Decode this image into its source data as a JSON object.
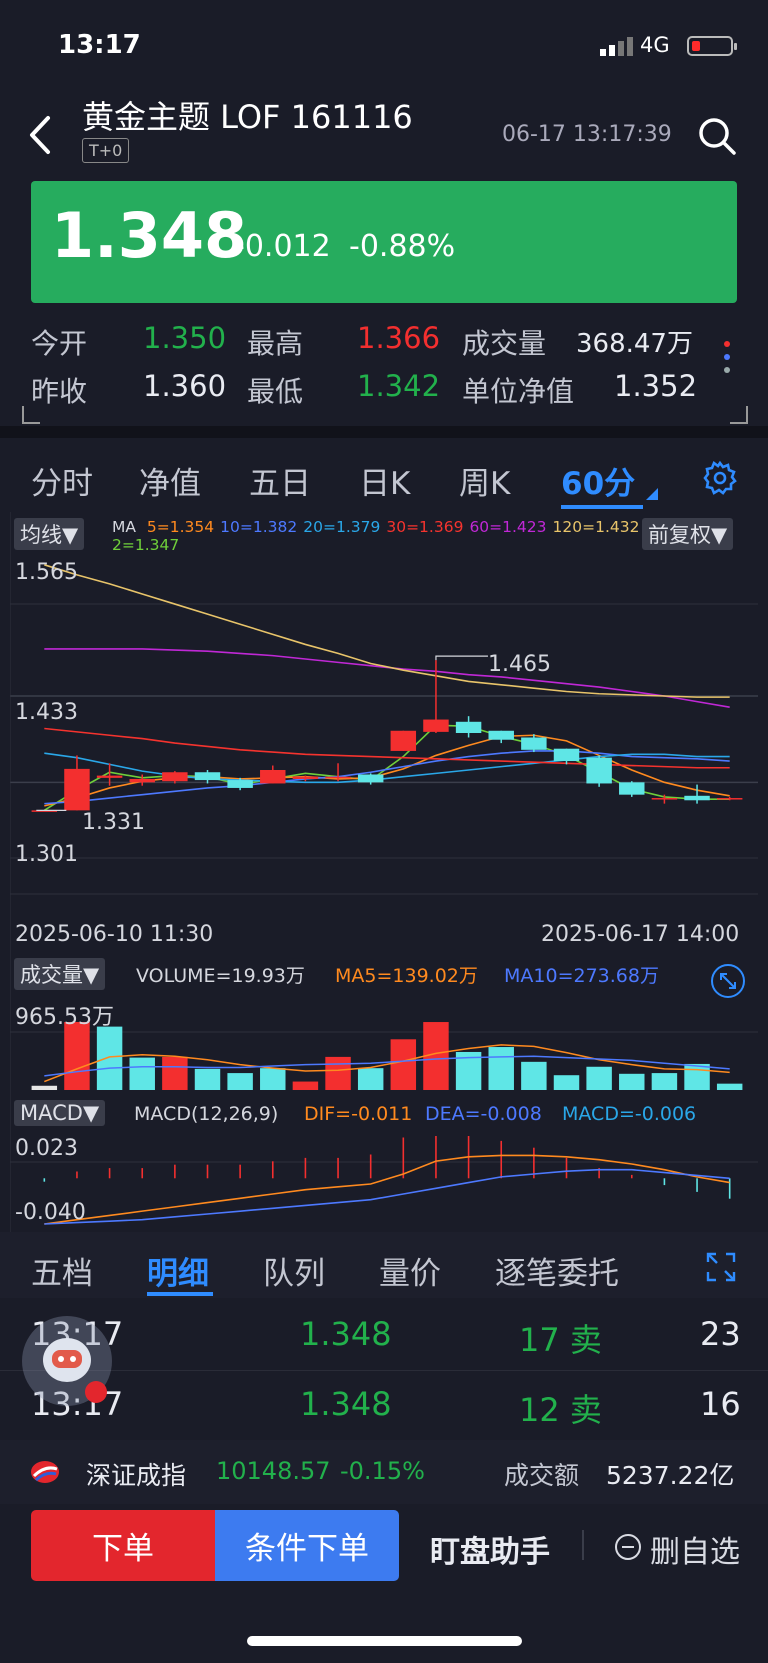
{
  "status": {
    "time": "13:17",
    "network": "4G"
  },
  "header": {
    "title": "黄金主题 LOF 161116",
    "badge": "T+0",
    "timestamp": "06-17 13:17:39"
  },
  "quote": {
    "price": "1.348",
    "change": "-0.012",
    "change_pct": "-0.88%"
  },
  "stats": {
    "open_label": "今开",
    "open": "1.350",
    "high_label": "最高",
    "high": "1.366",
    "volume_label": "成交量",
    "volume": "368.47万",
    "prev_label": "昨收",
    "prev": "1.360",
    "low_label": "最低",
    "low": "1.342",
    "nav_label": "单位净值",
    "nav": "1.352"
  },
  "tabs": [
    "分时",
    "净值",
    "五日",
    "日K",
    "周K",
    "60分"
  ],
  "chart": {
    "ma_pill": "均线▼",
    "ma_prefix": "MA",
    "ma_items": [
      {
        "text": "5=1.354",
        "color": "#ff8a1f"
      },
      {
        "text": "10=1.382",
        "color": "#4d79ff"
      },
      {
        "text": "20=1.379",
        "color": "#2aa7e8"
      },
      {
        "text": "30=1.369",
        "color": "#f5332e"
      },
      {
        "text": "60=1.423",
        "color": "#c028d6"
      },
      {
        "text": "120=1.432",
        "color": "#e8c46a"
      }
    ],
    "ma_item2": {
      "text": "2=1.347",
      "color": "#6fcf3a"
    },
    "adj_pill": "前复权▼",
    "y_top": "1.565",
    "y_mid": "1.433",
    "y_low": "1.301",
    "peak": "1.465",
    "trough": "1.331",
    "date_start": "2025-06-10 11:30",
    "date_end": "2025-06-17 14:00",
    "vol_pill": "成交量▼",
    "vol_text": "VOLUME=19.93万",
    "vol_ma5": "MA5=139.02万",
    "vol_ma10": "MA10=273.68万",
    "vol_max": "965.53万",
    "macd_pill": "MACD▼",
    "macd_text": "MACD(12,26,9)",
    "dif": "DIF=-0.011",
    "dea": "DEA=-0.008",
    "macd": "MACD=-0.006",
    "macd_top": "0.023",
    "macd_bot": "-0.040"
  },
  "chart_data": {
    "type": "candlestick",
    "period": "60分",
    "candles": [
      {
        "o": 1.331,
        "h": 1.331,
        "l": 1.331,
        "c": 1.331
      },
      {
        "o": 1.331,
        "h": 1.38,
        "l": 1.331,
        "c": 1.368
      },
      {
        "o": 1.36,
        "h": 1.373,
        "l": 1.353,
        "c": 1.362
      },
      {
        "o": 1.356,
        "h": 1.363,
        "l": 1.353,
        "c": 1.359
      },
      {
        "o": 1.357,
        "h": 1.366,
        "l": 1.355,
        "c": 1.365
      },
      {
        "o": 1.365,
        "h": 1.367,
        "l": 1.355,
        "c": 1.358
      },
      {
        "o": 1.358,
        "h": 1.36,
        "l": 1.349,
        "c": 1.351
      },
      {
        "o": 1.355,
        "h": 1.371,
        "l": 1.355,
        "c": 1.367
      },
      {
        "o": 1.359,
        "h": 1.362,
        "l": 1.357,
        "c": 1.361
      },
      {
        "o": 1.361,
        "h": 1.373,
        "l": 1.357,
        "c": 1.361
      },
      {
        "o": 1.363,
        "h": 1.364,
        "l": 1.354,
        "c": 1.356
      },
      {
        "o": 1.384,
        "h": 1.402,
        "l": 1.384,
        "c": 1.402
      },
      {
        "o": 1.401,
        "h": 1.465,
        "l": 1.4,
        "c": 1.412
      },
      {
        "o": 1.41,
        "h": 1.415,
        "l": 1.396,
        "c": 1.4
      },
      {
        "o": 1.402,
        "h": 1.402,
        "l": 1.391,
        "c": 1.394
      },
      {
        "o": 1.396,
        "h": 1.399,
        "l": 1.383,
        "c": 1.385
      },
      {
        "o": 1.386,
        "h": 1.386,
        "l": 1.372,
        "c": 1.375
      },
      {
        "o": 1.378,
        "h": 1.38,
        "l": 1.352,
        "c": 1.355
      },
      {
        "o": 1.356,
        "h": 1.357,
        "l": 1.343,
        "c": 1.345
      },
      {
        "o": 1.342,
        "h": 1.345,
        "l": 1.337,
        "c": 1.342
      },
      {
        "o": 1.344,
        "h": 1.354,
        "l": 1.337,
        "c": 1.34
      },
      {
        "o": 1.341,
        "h": 1.343,
        "l": 1.34,
        "c": 1.342
      }
    ],
    "volume": [
      60,
      965.53,
      900,
      460,
      470,
      300,
      240,
      310,
      120,
      470,
      310,
      720,
      965,
      540,
      610,
      400,
      210,
      330,
      230,
      240,
      370,
      90
    ],
    "vol_up": [
      false,
      true,
      false,
      false,
      true,
      false,
      false,
      false,
      true,
      true,
      false,
      true,
      true,
      false,
      false,
      false,
      false,
      false,
      false,
      false,
      false,
      false
    ],
    "ma_series": [
      {
        "name": "MA2",
        "color": "#6fcf3a",
        "values": [
          1.331,
          1.349,
          1.365,
          1.36,
          1.362,
          1.361,
          1.354,
          1.359,
          1.364,
          1.361,
          1.358,
          1.379,
          1.407,
          1.406,
          1.397,
          1.39,
          1.38,
          1.365,
          1.35,
          1.343,
          1.341,
          1.341
        ]
      },
      {
        "name": "MA5",
        "color": "#ff8a1f",
        "values": [
          1.335,
          1.342,
          1.351,
          1.357,
          1.36,
          1.361,
          1.359,
          1.36,
          1.361,
          1.359,
          1.36,
          1.368,
          1.38,
          1.389,
          1.397,
          1.398,
          1.393,
          1.38,
          1.367,
          1.356,
          1.349,
          1.344
        ]
      },
      {
        "name": "MA10",
        "color": "#4d79ff",
        "values": [
          1.337,
          1.339,
          1.342,
          1.345,
          1.348,
          1.351,
          1.353,
          1.356,
          1.359,
          1.361,
          1.365,
          1.37,
          1.375,
          1.379,
          1.382,
          1.384,
          1.384,
          1.382,
          1.379,
          1.378,
          1.377,
          1.375
        ]
      },
      {
        "name": "MA20",
        "color": "#2aa7e8",
        "values": [
          1.382,
          1.378,
          1.372,
          1.366,
          1.362,
          1.359,
          1.358,
          1.357,
          1.356,
          1.356,
          1.358,
          1.361,
          1.364,
          1.367,
          1.37,
          1.373,
          1.376,
          1.379,
          1.381,
          1.381,
          1.379,
          1.379
        ]
      },
      {
        "name": "MA30",
        "color": "#f5332e",
        "values": [
          1.404,
          1.401,
          1.398,
          1.395,
          1.391,
          1.388,
          1.385,
          1.383,
          1.381,
          1.38,
          1.379,
          1.378,
          1.377,
          1.376,
          1.375,
          1.374,
          1.373,
          1.372,
          1.371,
          1.37,
          1.369,
          1.369
        ]
      },
      {
        "name": "MA60",
        "color": "#c028d6",
        "values": [
          1.475,
          1.475,
          1.475,
          1.475,
          1.474,
          1.473,
          1.471,
          1.469,
          1.466,
          1.463,
          1.46,
          1.457,
          1.455,
          1.452,
          1.45,
          1.447,
          1.444,
          1.441,
          1.437,
          1.433,
          1.428,
          1.423
        ]
      },
      {
        "name": "MA120",
        "color": "#e8c46a",
        "values": [
          1.55,
          1.541,
          1.533,
          1.524,
          1.515,
          1.506,
          1.497,
          1.488,
          1.479,
          1.471,
          1.462,
          1.456,
          1.451,
          1.446,
          1.443,
          1.44,
          1.437,
          1.435,
          1.434,
          1.433,
          1.432,
          1.432
        ]
      }
    ],
    "vol_ma5": [
      120,
      300,
      470,
      500,
      480,
      430,
      360,
      310,
      270,
      280,
      320,
      410,
      520,
      590,
      640,
      620,
      530,
      430,
      360,
      300,
      290,
      250
    ],
    "vol_ma10": [
      200,
      260,
      310,
      330,
      330,
      320,
      320,
      340,
      360,
      370,
      380,
      410,
      440,
      460,
      470,
      480,
      460,
      440,
      420,
      380,
      340,
      300
    ],
    "macd_hist": [
      -0.001,
      0.002,
      0.003,
      0.003,
      0.004,
      0.004,
      0.004,
      0.005,
      0.006,
      0.006,
      0.007,
      0.012,
      0.018,
      0.014,
      0.011,
      0.009,
      0.006,
      0.003,
      0.001,
      -0.002,
      -0.004,
      -0.006
    ],
    "dif_series": [
      -0.04,
      -0.037,
      -0.034,
      -0.031,
      -0.028,
      -0.025,
      -0.022,
      -0.019,
      -0.016,
      -0.014,
      -0.012,
      -0.005,
      0.004,
      0.007,
      0.008,
      0.008,
      0.007,
      0.005,
      0.002,
      -0.002,
      -0.007,
      -0.011
    ],
    "dea_series": [
      -0.04,
      -0.039,
      -0.038,
      -0.037,
      -0.035,
      -0.033,
      -0.031,
      -0.029,
      -0.027,
      -0.025,
      -0.023,
      -0.019,
      -0.015,
      -0.011,
      -0.007,
      -0.005,
      -0.003,
      -0.002,
      -0.002,
      -0.004,
      -0.006,
      -0.008
    ],
    "ylim": [
      1.301,
      1.565
    ],
    "vol_max": 965.53,
    "macd_range": [
      -0.04,
      0.023
    ]
  },
  "detail_tabs": [
    "五档",
    "明细",
    "队列",
    "量价",
    "逐笔委托"
  ],
  "trades": [
    {
      "time": "13:17",
      "price": "1.348",
      "size": "17 卖",
      "count": "23"
    },
    {
      "time": "13:17",
      "price": "1.348",
      "size": "12 卖",
      "count": "16"
    }
  ],
  "index_bar": {
    "name": "深证成指",
    "value": "10148.57",
    "change": "-0.15%",
    "amount_label": "成交额",
    "amount": "5237.22亿"
  },
  "actions": {
    "order": "下单",
    "conditional": "条件下单",
    "helper": "盯盘助手",
    "remove": "删自选"
  },
  "colors": {
    "up": "#f32f2f",
    "down": "#5fe6e6",
    "accent": "#2f8cff",
    "price_bg": "#26ac5e"
  }
}
